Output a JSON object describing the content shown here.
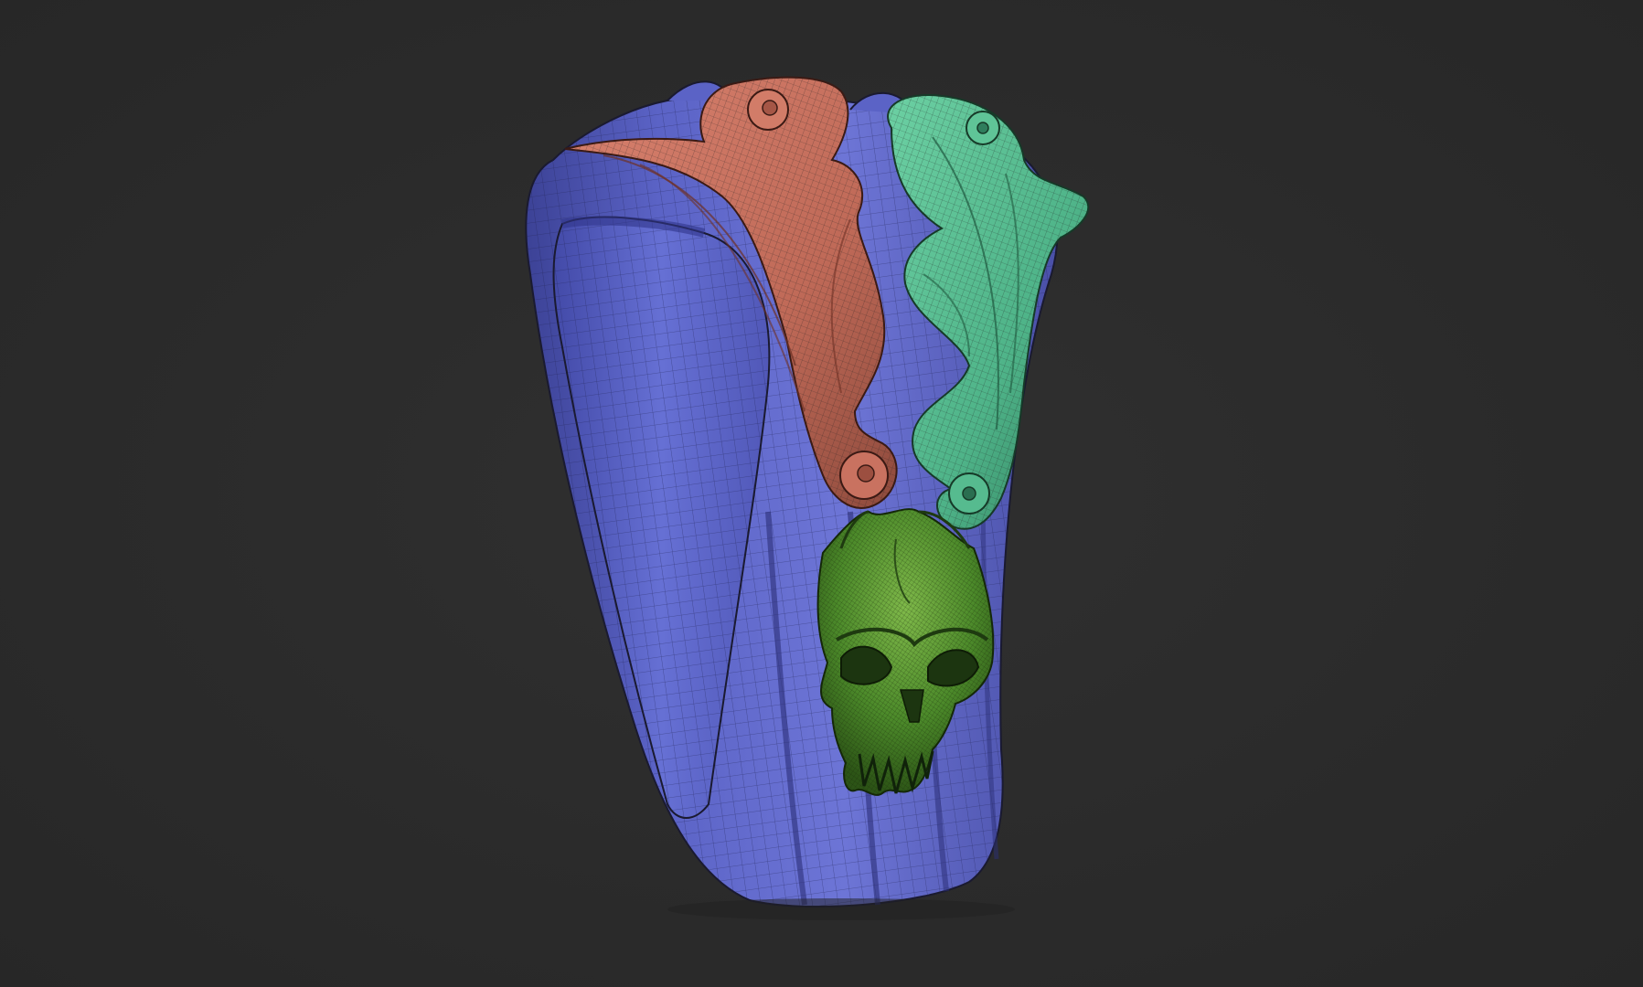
{
  "viewport": {
    "background_color": "#2b2b2b"
  },
  "model": {
    "subject": "ring-with-skull-and-acanthus-leaves",
    "display_mode": "polyframe-wireframe-overlay",
    "polygroups": [
      {
        "name": "ring-band",
        "color": "#5b63c6"
      },
      {
        "name": "left-leaf-ornament",
        "color": "#c87060"
      },
      {
        "name": "right-leaf-ornament",
        "color": "#4fb489"
      },
      {
        "name": "skull",
        "color": "#4c8a2a"
      }
    ],
    "wire_color": "#1c1c2a"
  }
}
